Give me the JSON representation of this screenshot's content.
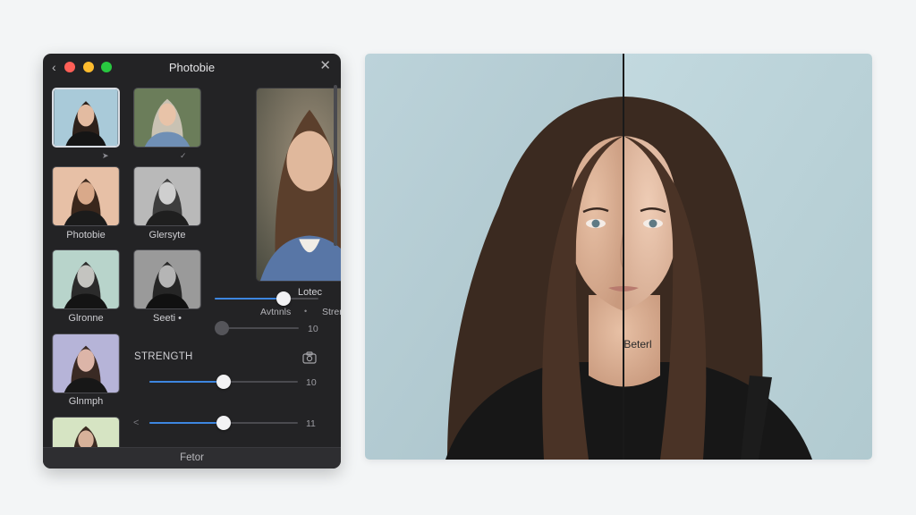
{
  "window": {
    "title": "Photobie",
    "footer_label": "Fetor"
  },
  "thumbnails": [
    {
      "label": "",
      "selected": true,
      "mark": "➤",
      "bg": "#a9cad9"
    },
    {
      "label": "",
      "selected": false,
      "mark": "✓",
      "bg": "#6b7d5a"
    },
    {
      "label": "Photobie",
      "selected": false,
      "mark": "",
      "bg": "#e7c0a6"
    },
    {
      "label": "Glersyte",
      "selected": false,
      "mark": "",
      "bg": "#b9b9b9"
    },
    {
      "label": "Glronne",
      "selected": false,
      "mark": "",
      "bg": "#b8d4cb"
    },
    {
      "label": "Seeti •",
      "selected": false,
      "mark": "",
      "bg": "#9a9a9a"
    },
    {
      "label": "Glnmph",
      "selected": false,
      "mark": "",
      "bg": "#b6b4d8"
    },
    {
      "label": "",
      "selected": false,
      "mark": "",
      "bg": "#d6e4c3"
    }
  ],
  "preview": {
    "label": "Lotec",
    "tab_a": "Avtnnls",
    "tab_dot": "•",
    "tab_b": "Strengyt"
  },
  "sliders": {
    "top": {
      "value": 0.66
    },
    "second": {
      "value": 0.0,
      "value_label": "10"
    },
    "strength_title": "STRENGTH",
    "strength": {
      "value": 0.5,
      "value_label": "10"
    },
    "bottom": {
      "value": 0.5,
      "value_label": "11"
    },
    "chevron": "<"
  },
  "compare": {
    "label": "Beterl"
  },
  "colors": {
    "accent": "#3d86e0",
    "window_bg": "#232325",
    "photo_bg": "#b9cfd6"
  }
}
